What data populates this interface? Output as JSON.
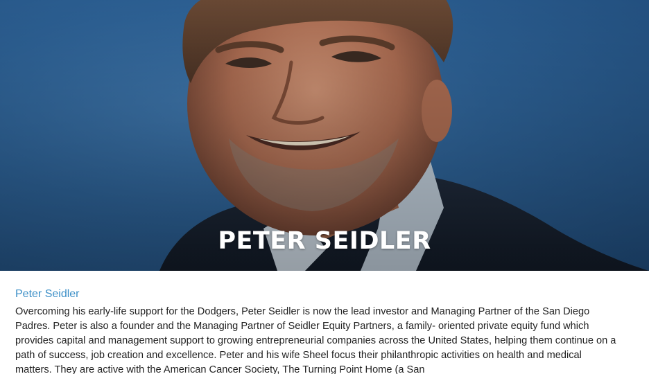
{
  "hero": {
    "title": "PETER SEIDLER",
    "photo_icon": "portrait-photo"
  },
  "bio": {
    "heading": "Peter Seidler",
    "paragraph": "Overcoming his early-life support for the Dodgers, Peter Seidler is now the lead investor and Managing Partner of the San Diego Padres. Peter is also a founder and the Managing Partner of Seidler Equity Partners, a family- oriented private equity fund which provides capital and management support to growing entrepreneurial companies across the United States, helping them continue on a path of success, job creation and excellence. Peter and his wife Sheel focus their philanthropic activities on health and medical matters. They are active with the American Cancer Society, The Turning Point Home (a San"
  },
  "colors": {
    "hero_background": "#2c5f92",
    "heading_accent": "#3c8fc7",
    "body_text": "#222222"
  }
}
